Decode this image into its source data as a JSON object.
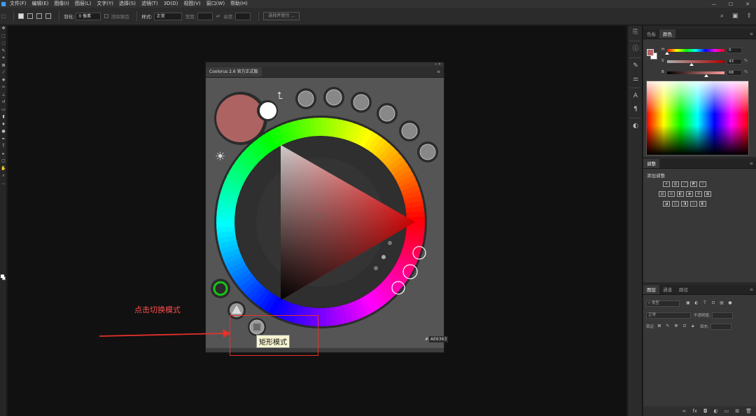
{
  "menu": [
    "文件(F)",
    "编辑(E)",
    "图像(I)",
    "图层(L)",
    "文字(Y)",
    "选择(S)",
    "滤镜(T)",
    "3D(D)",
    "视图(V)",
    "窗口(W)",
    "帮助(H)"
  ],
  "window_controls": [
    "—",
    "☐",
    "✕"
  ],
  "options": {
    "feather_label": "羽化:",
    "feather_value": "0 像素",
    "antialias_label": "消除锯齿",
    "style_label": "样式:",
    "style_value": "正常",
    "width_label": "宽度:",
    "height_label": "高度:",
    "select_mask_button": "选择并遮住 ..."
  },
  "coolorus": {
    "title": "Coolorus 2.6 官方正式版",
    "hex_hash": "#",
    "hex_value": "AE6363",
    "current_color": "#ae6363",
    "tooltip": "矩形模式"
  },
  "annotation": {
    "text": "点击切换模式",
    "color": "#e5312b"
  },
  "color_panel": {
    "tabs": [
      "色板",
      "颜色"
    ],
    "active_tab": 1,
    "fg_color": "#b06566",
    "sliders": [
      {
        "label": "H",
        "value": "0",
        "unit": "",
        "fraction": 0.0
      },
      {
        "label": "S",
        "value": "43",
        "unit": "%",
        "fraction": 0.43
      },
      {
        "label": "B",
        "value": "68",
        "unit": "%",
        "fraction": 0.68
      }
    ]
  },
  "adjust_panel": {
    "tabs": [
      "调整"
    ],
    "subtitle": "添加调整"
  },
  "layers_panel": {
    "tabs": [
      "图层",
      "通道",
      "路径"
    ],
    "active_tab": 0,
    "kind_label": "类型",
    "blend_mode": "正常",
    "opacity_label": "不透明度:",
    "lock_label": "锁定:",
    "fill_label": "填充:"
  }
}
